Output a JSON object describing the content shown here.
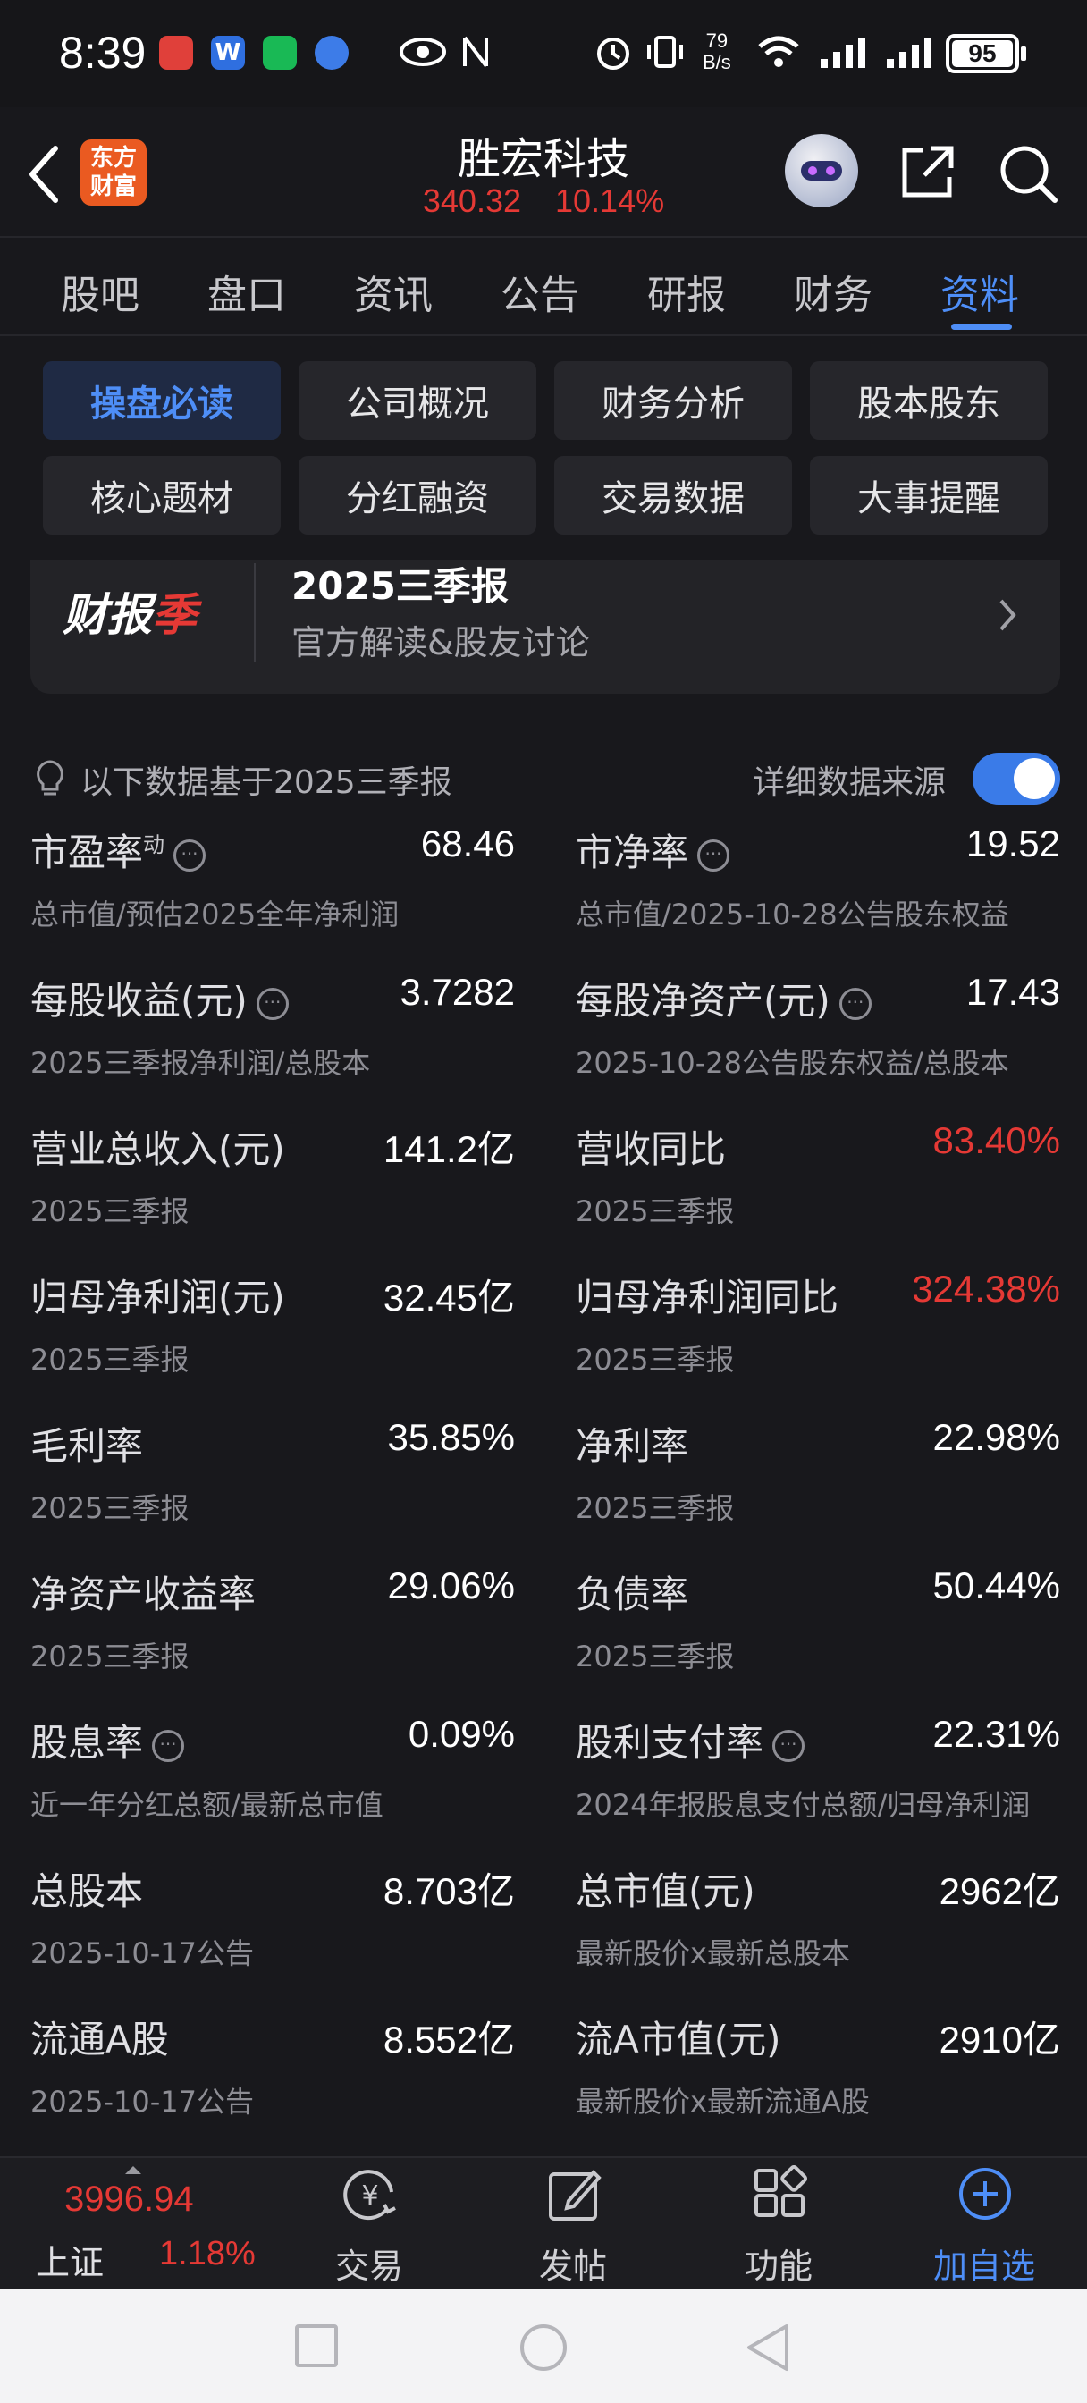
{
  "status_bar": {
    "time": "8:39",
    "net_speed_top": "79",
    "net_speed_bottom": "B/s",
    "battery": "95",
    "icons": [
      "app-icon-red",
      "app-icon-w",
      "wechat-icon",
      "browser-icon",
      "eye-icon",
      "nfc-icon",
      "alarm-icon",
      "vibrate-icon",
      "wifi-icon",
      "signal-icon",
      "signal-icon",
      "battery-icon"
    ]
  },
  "header": {
    "logo_line1": "东方",
    "logo_line2": "财富",
    "title": "胜宏科技",
    "price": "340.32",
    "change_pct": "10.14%",
    "colors": {
      "up": "#e53935",
      "accent": "#4e8ef7"
    }
  },
  "tabs": [
    "股吧",
    "盘口",
    "资讯",
    "公告",
    "研报",
    "财务",
    "资料"
  ],
  "active_tab": "资料",
  "sub_tabs": {
    "row1": [
      "操盘必读",
      "公司概况",
      "财务分析",
      "股本股东"
    ],
    "row2": [
      "核心题材",
      "分红融资",
      "交易数据",
      "大事提醒"
    ],
    "active": "操盘必读"
  },
  "banner": {
    "logo_text_a": "财报",
    "logo_text_b": "季",
    "title": "2025三季报",
    "subtitle": "官方解读&股友讨论"
  },
  "note": {
    "text": "以下数据基于2025三季报",
    "source_label": "详细数据来源",
    "source_toggle_on": true
  },
  "metrics": [
    [
      {
        "label": "市盈率",
        "sup": "动",
        "info": true,
        "value": "68.46",
        "sub": "总市值/预估2025全年净利润",
        "red": false
      },
      {
        "label": "市净率",
        "info": true,
        "value": "19.52",
        "sub": "总市值/2025-10-28公告股东权益",
        "red": false
      }
    ],
    [
      {
        "label": "每股收益(元)",
        "info": true,
        "value": "3.7282",
        "sub": "2025三季报净利润/总股本",
        "red": false
      },
      {
        "label": "每股净资产(元)",
        "info": true,
        "value": "17.43",
        "sub": "2025-10-28公告股东权益/总股本",
        "red": false
      }
    ],
    [
      {
        "label": "营业总收入(元)",
        "info": false,
        "value": "141.2亿",
        "sub": "2025三季报",
        "red": false
      },
      {
        "label": "营收同比",
        "info": false,
        "value": "83.40%",
        "sub": "2025三季报",
        "red": true
      }
    ],
    [
      {
        "label": "归母净利润(元)",
        "info": false,
        "value": "32.45亿",
        "sub": "2025三季报",
        "red": false
      },
      {
        "label": "归母净利润同比",
        "info": false,
        "value": "324.38%",
        "sub": "2025三季报",
        "red": true
      }
    ],
    [
      {
        "label": "毛利率",
        "info": false,
        "value": "35.85%",
        "sub": "2025三季报",
        "red": false
      },
      {
        "label": "净利率",
        "info": false,
        "value": "22.98%",
        "sub": "2025三季报",
        "red": false
      }
    ],
    [
      {
        "label": "净资产收益率",
        "info": false,
        "value": "29.06%",
        "sub": "2025三季报",
        "red": false
      },
      {
        "label": "负债率",
        "info": false,
        "value": "50.44%",
        "sub": "2025三季报",
        "red": false
      }
    ],
    [
      {
        "label": "股息率",
        "info": true,
        "value": "0.09%",
        "sub": "近一年分红总额/最新总市值",
        "red": false
      },
      {
        "label": "股利支付率",
        "info": true,
        "value": "22.31%",
        "sub": "2024年报股息支付总额/归母净利润",
        "red": false
      }
    ],
    [
      {
        "label": "总股本",
        "info": false,
        "value": "8.703亿",
        "sub": "2025-10-17公告",
        "red": false
      },
      {
        "label": "总市值(元)",
        "info": false,
        "value": "2962亿",
        "sub": "最新股价x最新总股本",
        "red": false
      }
    ],
    [
      {
        "label": "流通A股",
        "info": false,
        "value": "8.552亿",
        "sub": "2025-10-17公告",
        "red": false
      },
      {
        "label": "流A市值(元)",
        "info": false,
        "value": "2910亿",
        "sub": "最新股价x最新流通A股",
        "red": false
      }
    ]
  ],
  "index_ticker": {
    "value": "3996.94",
    "name": "上证",
    "change_pct": "1.18%"
  },
  "bottom_nav": [
    {
      "label": "交易",
      "icon": "yen-exchange-icon"
    },
    {
      "label": "发帖",
      "icon": "edit-icon"
    },
    {
      "label": "功能",
      "icon": "grid-apps-icon"
    },
    {
      "label": "加自选",
      "icon": "plus-circle-icon"
    }
  ]
}
